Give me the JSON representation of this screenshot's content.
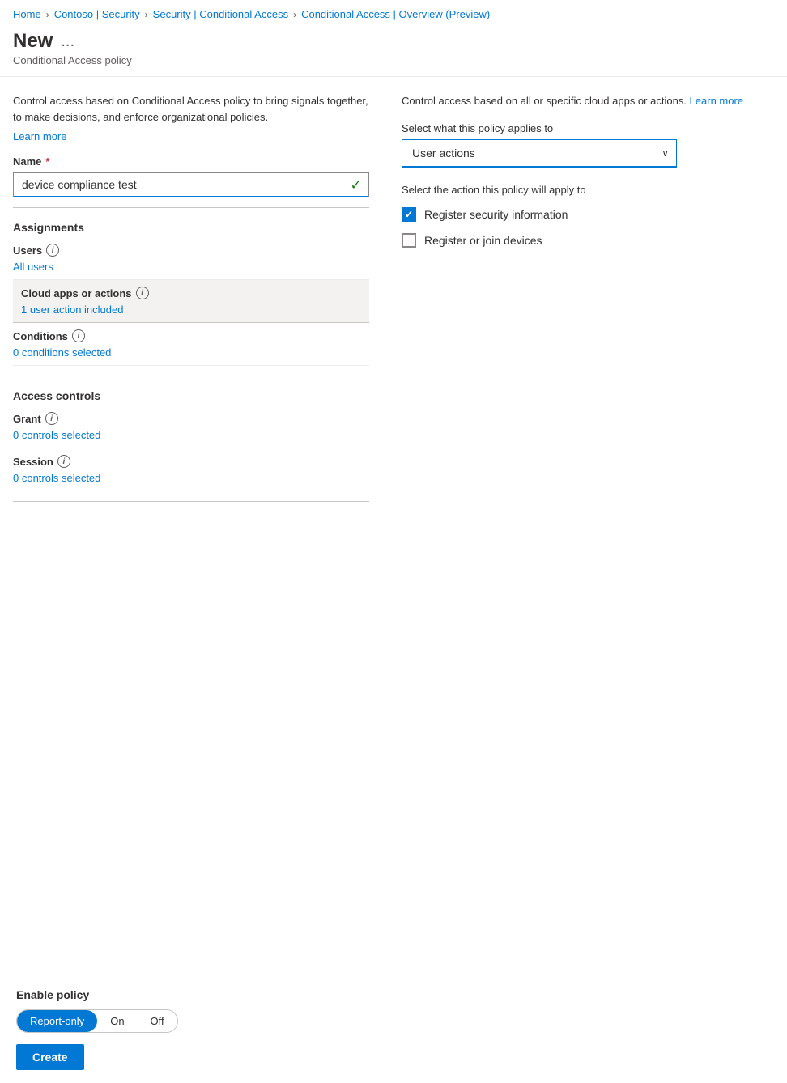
{
  "breadcrumb": {
    "items": [
      {
        "label": "Home",
        "href": "#"
      },
      {
        "label": "Contoso | Security",
        "href": "#"
      },
      {
        "label": "Security | Conditional Access",
        "href": "#"
      },
      {
        "label": "Conditional Access | Overview (Preview)",
        "href": "#"
      }
    ]
  },
  "header": {
    "title": "New",
    "ellipsis": "...",
    "subtitle": "Conditional Access policy"
  },
  "left": {
    "description": "Control access based on Conditional Access policy to bring signals together, to make decisions, and enforce organizational policies.",
    "learn_more": "Learn more",
    "name_label": "Name",
    "name_value": "device compliance test",
    "assignments_heading": "Assignments",
    "users_label": "Users",
    "users_value": "All users",
    "cloud_apps_label": "Cloud apps or actions",
    "cloud_apps_value": "1 user action included",
    "conditions_label": "Conditions",
    "conditions_value": "0 conditions selected",
    "access_controls_heading": "Access controls",
    "grant_label": "Grant",
    "grant_value": "0 controls selected",
    "session_label": "Session",
    "session_value": "0 controls selected"
  },
  "right": {
    "description": "Control access based on all or specific cloud apps or actions.",
    "learn_more": "Learn more",
    "applies_label": "Select what this policy applies to",
    "dropdown_value": "User actions",
    "action_label": "Select the action this policy will apply to",
    "checkboxes": [
      {
        "label": "Register security information",
        "checked": true
      },
      {
        "label": "Register or join devices",
        "checked": false
      }
    ]
  },
  "bottom": {
    "enable_label": "Enable policy",
    "toggle_options": [
      {
        "label": "Report-only",
        "active": true
      },
      {
        "label": "On",
        "active": false
      },
      {
        "label": "Off",
        "active": false
      }
    ],
    "create_label": "Create"
  }
}
